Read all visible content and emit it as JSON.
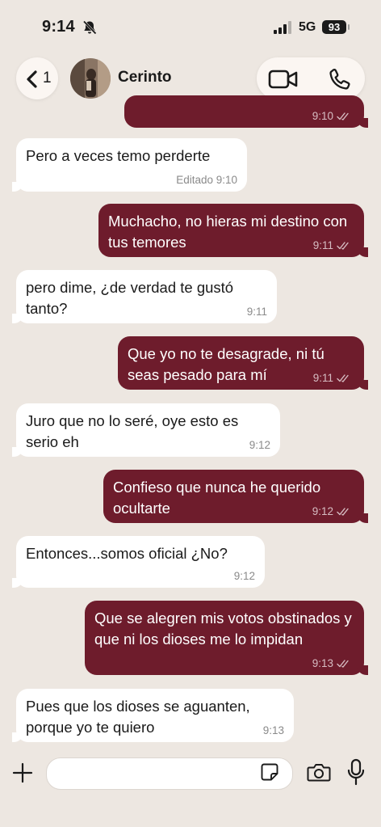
{
  "status_bar": {
    "time": "9:14",
    "network": "5G",
    "battery": "93"
  },
  "header": {
    "back_count": "1",
    "contact_name": "Cerinto"
  },
  "messages": [
    {
      "direction": "outgoing",
      "text": "",
      "time": "9:10"
    },
    {
      "direction": "incoming",
      "text": "Pero a veces temo perderte",
      "time": "Editado 9:10"
    },
    {
      "direction": "outgoing",
      "text": "Muchacho, no hieras mi destino con tus temores",
      "time": "9:11"
    },
    {
      "direction": "incoming",
      "text": "pero dime, ¿de verdad te gustó tanto?",
      "time": "9:11"
    },
    {
      "direction": "outgoing",
      "text": "Que yo no te desagrade, ni tú seas pesado para mí",
      "time": "9:11"
    },
    {
      "direction": "incoming",
      "text": "Juro que no lo seré, oye esto es serio eh",
      "time": "9:12"
    },
    {
      "direction": "outgoing",
      "text": "Confieso que nunca he querido ocultarte",
      "time": "9:12"
    },
    {
      "direction": "incoming",
      "text": "Entonces...somos oficial ¿No?",
      "time": "9:12"
    },
    {
      "direction": "outgoing",
      "text": "Que se alegren mis votos obstinados y que ni los dioses me lo impidan",
      "time": "9:13"
    },
    {
      "direction": "incoming",
      "text": "Pues que los dioses se aguanten, porque yo te quiero",
      "time": "9:13"
    }
  ],
  "composer": {
    "input_value": ""
  },
  "colors": {
    "background": "#ede7e1",
    "outgoing_bubble": "#6e1c2c",
    "incoming_bubble": "#ffffff"
  },
  "icons": [
    "bell-slash-icon",
    "signal-icon",
    "back-chevron-icon",
    "video-call-icon",
    "phone-icon",
    "read-ticks-icon",
    "plus-icon",
    "sticker-icon",
    "camera-icon",
    "microphone-icon"
  ]
}
